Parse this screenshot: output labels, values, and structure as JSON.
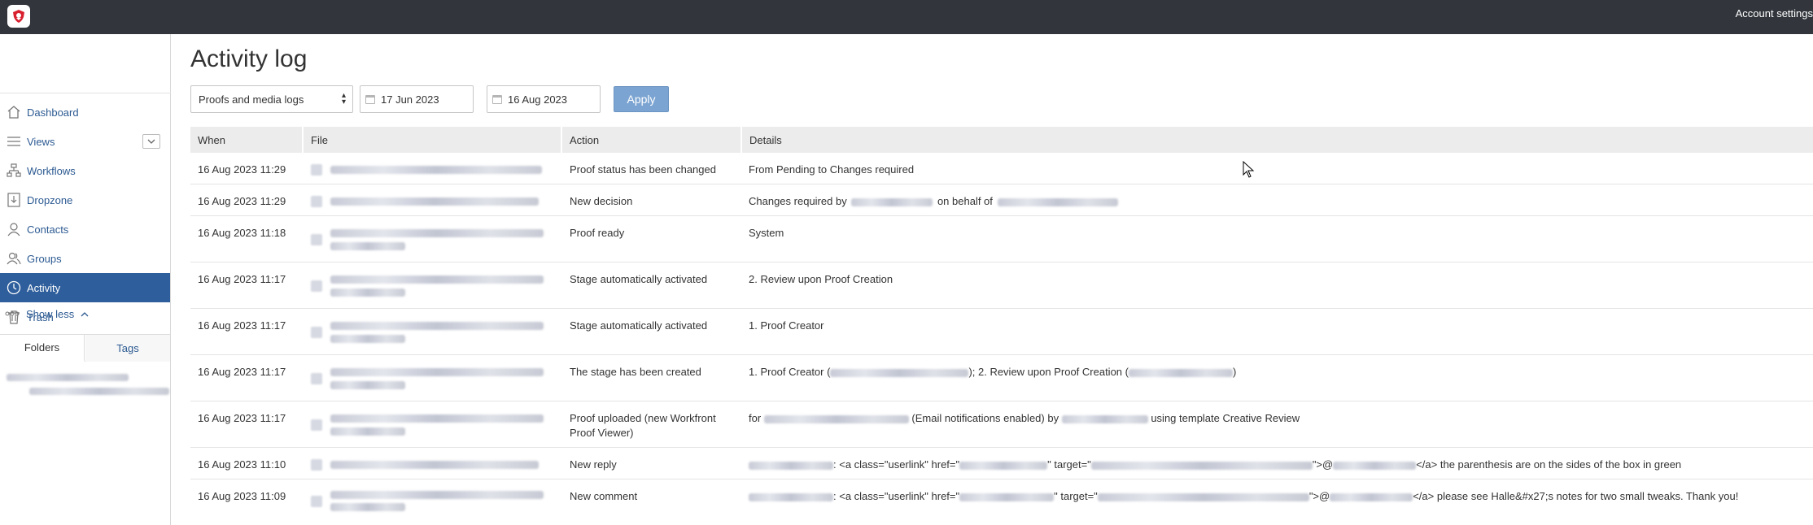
{
  "header": {
    "account_settings": "Account settings"
  },
  "sidebar": {
    "items": [
      {
        "label": "Dashboard",
        "icon": "home-icon"
      },
      {
        "label": "Views",
        "icon": "list-icon"
      },
      {
        "label": "Workflows",
        "icon": "workflow-icon"
      },
      {
        "label": "Dropzone",
        "icon": "dropzone-icon"
      },
      {
        "label": "Contacts",
        "icon": "contact-icon"
      },
      {
        "label": "Groups",
        "icon": "group-icon"
      },
      {
        "label": "Activity",
        "icon": "clock-icon",
        "active": true
      },
      {
        "label": "Trash",
        "icon": "trash-icon"
      }
    ],
    "show_less": "Show less",
    "tabs": {
      "folders": "Folders",
      "tags": "Tags"
    }
  },
  "page": {
    "title": "Activity log",
    "filter": {
      "selected": "Proofs and media logs"
    },
    "date_from": "17 Jun 2023",
    "date_to": "16 Aug 2023",
    "apply_label": "Apply"
  },
  "table": {
    "headers": {
      "when": "When",
      "file": "File",
      "action": "Action",
      "details": "Details"
    },
    "rows": [
      {
        "when": "16 Aug 2023 11:29",
        "action": "Proof status has been changed",
        "details": "From Pending to Changes required"
      },
      {
        "when": "16 Aug 2023 11:29",
        "action": "New decision",
        "details_pre": "Changes required by",
        "details_mid": "on behalf of"
      },
      {
        "when": "16 Aug 2023 11:18",
        "action": "Proof ready",
        "details": "System"
      },
      {
        "when": "16 Aug 2023 11:17",
        "action": "Stage automatically activated",
        "details": "2. Review upon Proof Creation"
      },
      {
        "when": "16 Aug 2023 11:17",
        "action": "Stage automatically activated",
        "details": "1. Proof Creator"
      },
      {
        "when": "16 Aug 2023 11:17",
        "action": "The stage has been created",
        "details_a": "1. Proof Creator (",
        "details_b": "); 2. Review upon Proof Creation (",
        "details_c": ")"
      },
      {
        "when": "16 Aug 2023 11:17",
        "action": "Proof uploaded (new Workfront Proof Viewer)",
        "details_a": "for",
        "details_b": "(Email notifications enabled) by",
        "details_c": "using template Creative Review"
      },
      {
        "when": "16 Aug 2023 11:10",
        "action": "New reply",
        "details_a": ": <a class=\"userlink\" href=\"",
        "details_b": "\" target=\"",
        "details_c": "\">@",
        "details_d": "</a> the parenthesis are on the sides of the box in green"
      },
      {
        "when": "16 Aug 2023 11:09",
        "action": "New comment",
        "details_a": ": <a class=\"userlink\" href=\"",
        "details_b": "\" target=\"",
        "details_c": "\">@",
        "details_d": "</a> please see Halle&#x27;s notes for two small tweaks. Thank you!"
      }
    ]
  }
}
